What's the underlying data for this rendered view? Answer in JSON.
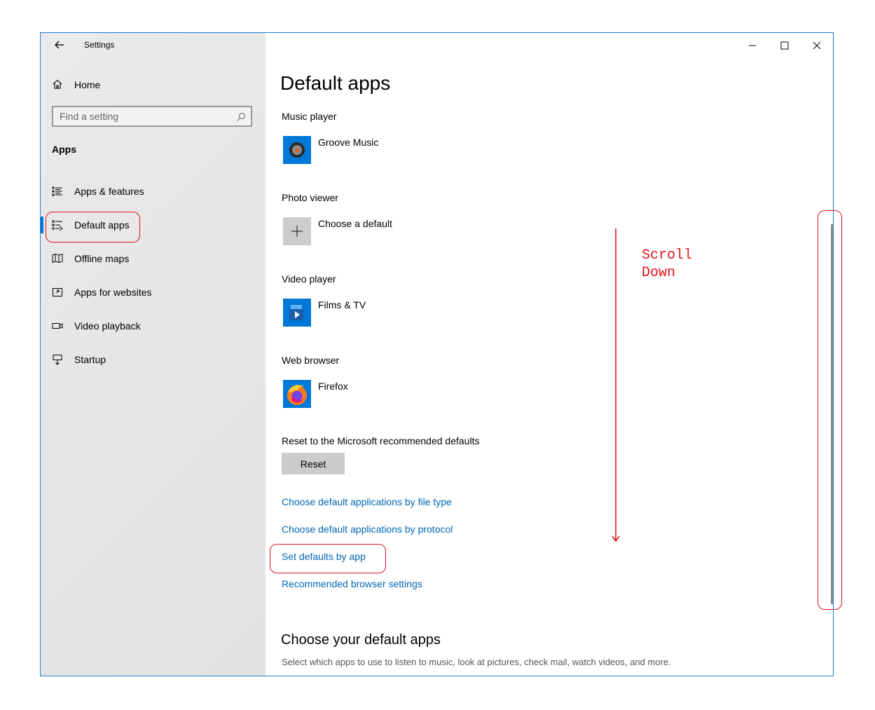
{
  "window": {
    "title": "Settings",
    "controls": {
      "minimize": "minimize-icon",
      "maximize": "maximize-icon",
      "close": "close-icon"
    }
  },
  "sidebar": {
    "home_label": "Home",
    "search_placeholder": "Find a setting",
    "section_label": "Apps",
    "items": [
      {
        "label": "Apps & features",
        "icon": "apps-features-icon",
        "active": false
      },
      {
        "label": "Default apps",
        "icon": "default-apps-icon",
        "active": true
      },
      {
        "label": "Offline maps",
        "icon": "map-icon",
        "active": false
      },
      {
        "label": "Apps for websites",
        "icon": "apps-websites-icon",
        "active": false
      },
      {
        "label": "Video playback",
        "icon": "video-icon",
        "active": false
      },
      {
        "label": "Startup",
        "icon": "startup-icon",
        "active": false
      }
    ]
  },
  "main": {
    "title": "Default apps",
    "categories": [
      {
        "label": "Music player",
        "app": "Groove Music",
        "icon": "groove-music-icon"
      },
      {
        "label": "Photo viewer",
        "app": "Choose a default",
        "icon": "plus-icon"
      },
      {
        "label": "Video player",
        "app": "Films & TV",
        "icon": "films-tv-icon"
      },
      {
        "label": "Web browser",
        "app": "Firefox",
        "icon": "firefox-icon"
      }
    ],
    "reset_label": "Reset to the Microsoft recommended defaults",
    "reset_button": "Reset",
    "links": [
      "Choose default applications by file type",
      "Choose default applications by protocol",
      "Set defaults by app",
      "Recommended browser settings"
    ],
    "sub_heading": "Choose your default apps",
    "sub_desc": "Select which apps to use to listen to music, look at pictures, check mail, watch videos, and more."
  },
  "annotation": {
    "note": "Scroll\nDown",
    "color": "#e0141b"
  },
  "colors": {
    "accent": "#0078d7",
    "link": "#0066b4",
    "annotation": "#e0141b"
  }
}
